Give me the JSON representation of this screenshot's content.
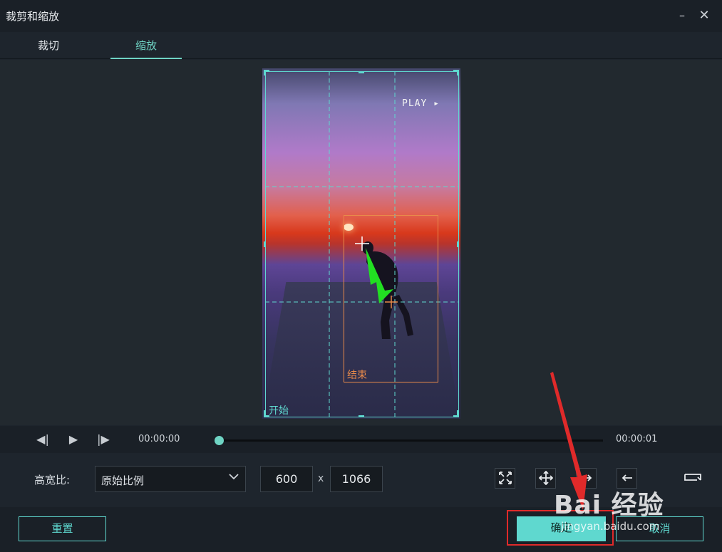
{
  "window": {
    "title": "裁剪和缩放",
    "minimize": "–",
    "close": "✕"
  },
  "tabs": [
    {
      "label": "裁切"
    },
    {
      "label": "缩放"
    }
  ],
  "preview": {
    "video_overlay_text": "PLAY ▸",
    "start_label": "开始",
    "end_label": "结束",
    "colors": {
      "start_frame": "#5fd8cf",
      "end_frame": "#e88a4a",
      "motion_arrow": "#22e022"
    }
  },
  "transport": {
    "prev_frame_icon": "◀|",
    "play_icon": "▶",
    "next_frame_icon": "|▶",
    "current_time": "00:00:00",
    "end_time": "00:00:01",
    "progress": 0
  },
  "settings": {
    "ratio_label": "高宽比:",
    "ratio_value": "原始比例",
    "width": "600",
    "times": "x",
    "height": "1066"
  },
  "footer": {
    "reset": "重置",
    "ok": "确定",
    "cancel": "取消"
  },
  "watermark": {
    "brand": "Bai 经验",
    "url": "jingyan.baidu.com"
  },
  "accent_color": "#5fd8cf",
  "annotation_color": "#e02a2a"
}
